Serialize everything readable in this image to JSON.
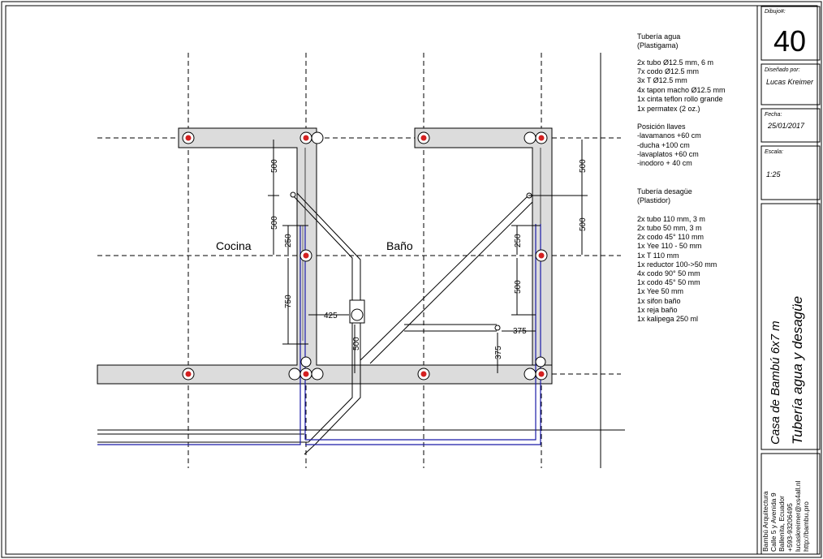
{
  "rooms": {
    "kitchen": "Cocina",
    "bath": "Baño"
  },
  "dimensions": {
    "d500a": "500",
    "d500b": "500",
    "d250a": "250",
    "d750": "750",
    "d425": "425",
    "d500c": "500",
    "d500d": "500",
    "d500e": "500",
    "d250b": "250",
    "d500f": "500",
    "d375a": "375",
    "d375b": "375"
  },
  "notes": {
    "water_title": "Tubería agua",
    "water_sub": "(Plastigama)",
    "water_items": [
      "2x tubo Ø12.5 mm, 6 m",
      "7x codo Ø12.5 mm",
      "3x T Ø12.5 mm",
      "4x tapon macho  Ø12.5 mm",
      "1x cinta teflon rollo grande",
      "1x permatex (2 oz.)"
    ],
    "valves_title": "Posición llaves",
    "valves_items": [
      "-lavamanos +60 cm",
      "-ducha +100 cm",
      "-lavaplatos +60 cm",
      "-inodoro + 40 cm"
    ],
    "drain_title": "Tubería desagüe",
    "drain_sub": "(Plastidor)",
    "drain_items": [
      "2x tubo 110 mm, 3 m",
      "2x tubo 50 mm, 3 m",
      "2x codo 45° 110 mm",
      "1x Yee 110 - 50 mm",
      "1x T 110 mm",
      "1x reductor 100->50 mm",
      "4x codo 90° 50 mm",
      "1x codo 45° 50 mm",
      "1x Yee 50 mm",
      "1x sifon baño",
      "1x reja baño",
      "1x kalipega 250 ml"
    ]
  },
  "title_block": {
    "dibujo_label": "Dibujo#:",
    "dibujo_number": "40",
    "designer_label": "Diseñado por:",
    "designer": "Lucas Kreimer",
    "date_label": "Fecha:",
    "date": "25/01/2017",
    "scale_label": "Escala:",
    "scale": "1:25",
    "project": "Casa de Bambú 6x7 m",
    "sheet_title": "Tubería agua y desagüe",
    "company_lines": [
      "Bambú Arquitectura",
      "Calle 5 y Avenida 9",
      "Ballenita, Ecuador",
      "+593-93206495",
      "lucaskreimer@xs4all.nl",
      "http://bambu.pro"
    ]
  },
  "colors": {
    "beam_fill": "#dcdcdc",
    "column_dot": "#d42020",
    "water_pipe": "#1a1aa8",
    "line": "#000000"
  }
}
